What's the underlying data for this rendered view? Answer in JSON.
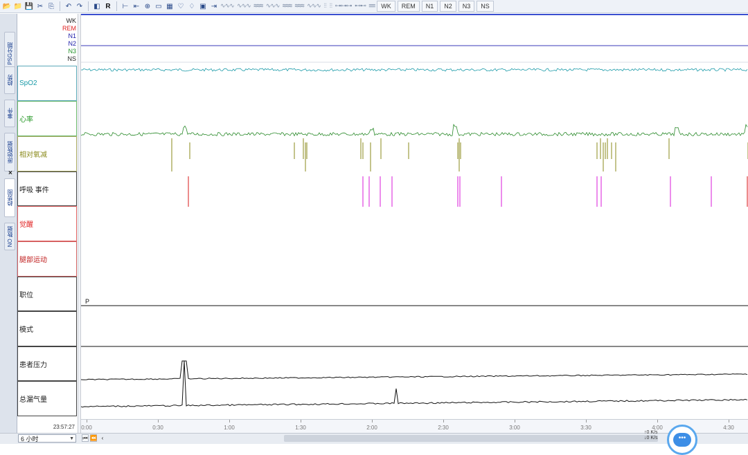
{
  "toolbar": {
    "stage_buttons": [
      "WK",
      "REM",
      "N1",
      "N2",
      "N3",
      "NS"
    ]
  },
  "left_tabs": [
    {
      "label": "PSG分期",
      "icon": "tab"
    },
    {
      "label": "趋势",
      "icon": "tab"
    },
    {
      "label": "事件",
      "icon": "tab"
    },
    {
      "label": "原始数据",
      "icon": "tab"
    },
    {
      "label": "趋势图",
      "icon": "tab",
      "active": true
    },
    {
      "label": "NO 数据",
      "icon": "tab"
    }
  ],
  "hypnogram": {
    "stages": [
      {
        "label": "WK",
        "color": "#222222"
      },
      {
        "label": "REM",
        "color": "#e02020"
      },
      {
        "label": "N1",
        "color": "#1a1aa8"
      },
      {
        "label": "N2",
        "color": "#1a1aa8"
      },
      {
        "label": "N3",
        "color": "#22922a"
      },
      {
        "label": "NS",
        "color": "#222222"
      }
    ]
  },
  "channels": [
    {
      "label": "SpO2",
      "color": "#1a9aa8",
      "border": "#5aa8b8"
    },
    {
      "label": "心率",
      "color": "#2a9a2a",
      "border": "#6ab86a"
    },
    {
      "label": "相对氧减",
      "color": "#8a8a1a",
      "border": "#a8a860"
    },
    {
      "label": "呼吸 事件",
      "color": "#222222",
      "border": "#444444"
    },
    {
      "label": "觉醒",
      "color": "#e02020",
      "border": "#e06060"
    },
    {
      "label": "腿部运动",
      "color": "#c02020",
      "border": "#d06060"
    },
    {
      "label": "职位",
      "color": "#222222",
      "border": "#444444"
    },
    {
      "label": "模式",
      "color": "#222222",
      "border": "#444444"
    },
    {
      "label": "患者压力",
      "color": "#222222",
      "border": "#444444"
    },
    {
      "label": "总漏气量",
      "color": "#222222",
      "border": "#444444"
    }
  ],
  "position_marker": "P",
  "time_axis": {
    "ticks": [
      "0:00",
      "0:30",
      "1:00",
      "1:30",
      "2:00",
      "2:30",
      "3:00",
      "3:30",
      "4:00",
      "4:30"
    ]
  },
  "clock": "23:57:27",
  "duration": {
    "value": "6 小时"
  },
  "net_widget": {
    "up": "↑0  K/s",
    "down": "↓0  K/s"
  },
  "colors": {
    "spo2": "#1a9aa8",
    "hr": "#2a8a2a",
    "desat": "#8a8a1a",
    "resp": "#e040e0",
    "resp_red": "#e04040",
    "trace_black": "#111111",
    "hypno_line": "#3a3ab8"
  }
}
